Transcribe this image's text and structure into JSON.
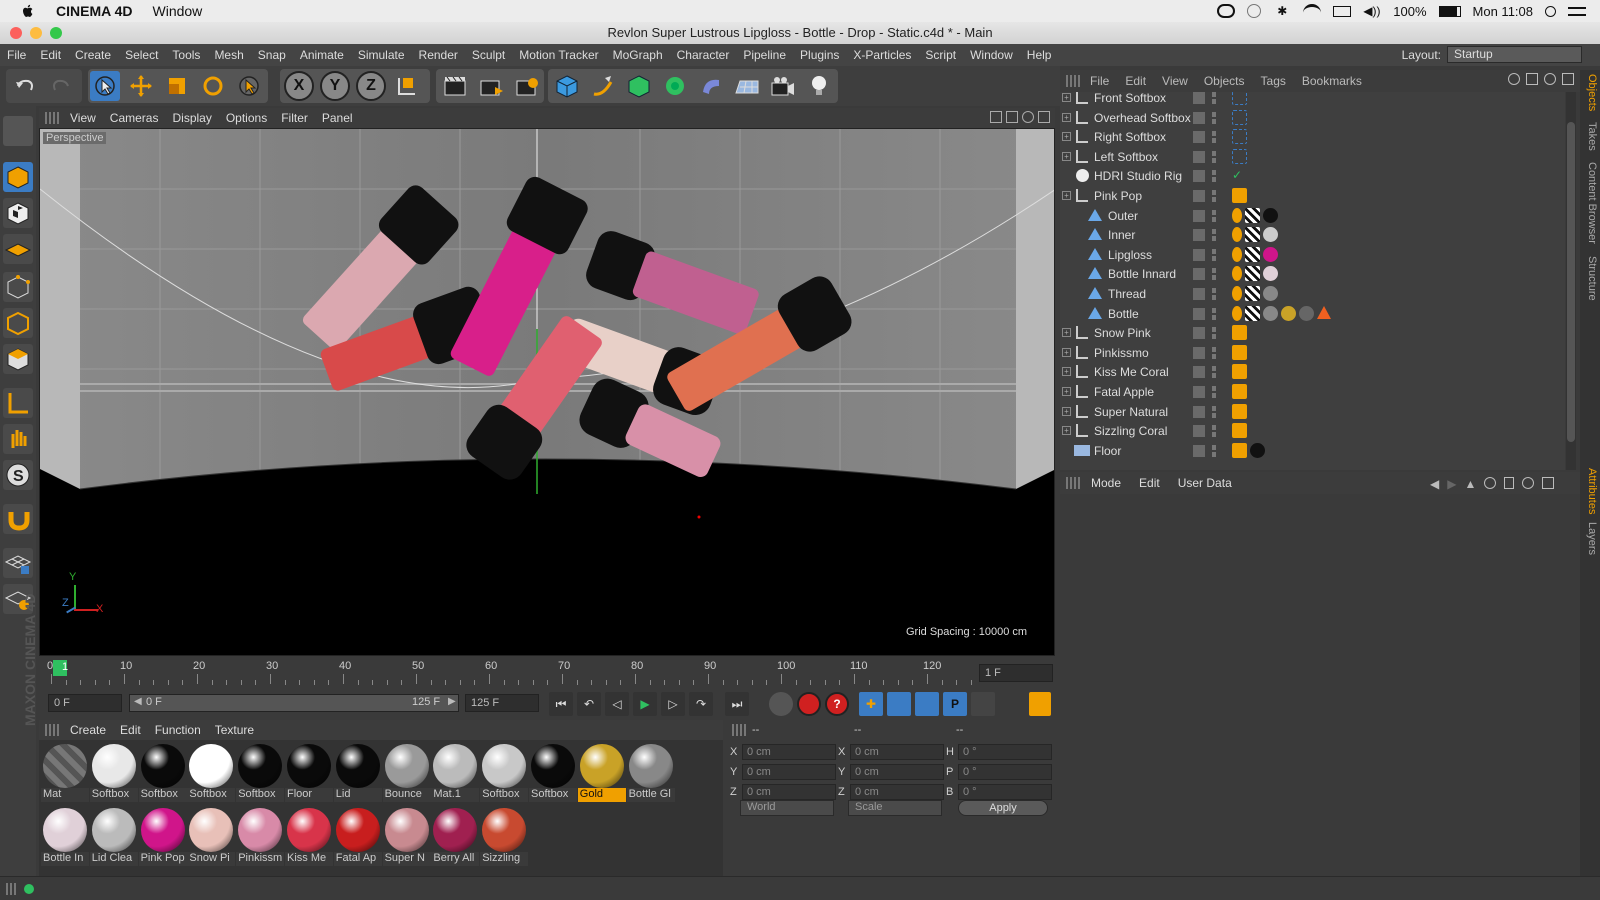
{
  "mac_menubar": {
    "app_name": "CINEMA 4D",
    "menu": [
      "Window"
    ],
    "battery": "100%",
    "clock": "Mon 11:08"
  },
  "window_title": "Revlon Super Lustrous Lipgloss - Bottle - Drop - Static.c4d * - Main",
  "app_menu": [
    "File",
    "Edit",
    "Create",
    "Select",
    "Tools",
    "Mesh",
    "Snap",
    "Animate",
    "Simulate",
    "Render",
    "Sculpt",
    "Motion Tracker",
    "MoGraph",
    "Character",
    "Pipeline",
    "Plugins",
    "X-Particles",
    "Script",
    "Window",
    "Help"
  ],
  "layout": {
    "label": "Layout:",
    "value": "Startup"
  },
  "toolbar_axes": [
    "X",
    "Y",
    "Z"
  ],
  "viewport": {
    "menu": [
      "View",
      "Cameras",
      "Display",
      "Options",
      "Filter",
      "Panel"
    ],
    "camera_label": "Perspective",
    "grid_spacing": "Grid Spacing : 10000 cm",
    "axis_y": "Y",
    "axis_z": "Z",
    "axis_x": "X"
  },
  "timeline": {
    "ticks": [
      "0",
      "10",
      "20",
      "30",
      "40",
      "50",
      "60",
      "70",
      "80",
      "90",
      "100",
      "110",
      "120"
    ],
    "current_frame_marker": "1",
    "frame_display": "1 F",
    "start_field": "0 F",
    "range_start": "0 F",
    "range_end": "125 F",
    "end_field": "125 F"
  },
  "material_manager": {
    "menu": [
      "Create",
      "Edit",
      "Function",
      "Texture"
    ],
    "row1": [
      "Mat",
      "Softbox",
      "Softbox",
      "Softbox",
      "Softbox",
      "Floor",
      "Lid",
      "Bounce",
      "Mat.1",
      "Softbox",
      "Softbox",
      "Gold",
      "Bottle Gl"
    ],
    "row1_colors": [
      "stripe",
      "#e8e8e8",
      "#0a0a0a",
      "#ffffff",
      "#0a0a0a",
      "#0a0a0a",
      "#0a0a0a",
      "#9a9a9a",
      "#bbbbbb",
      "#c8c8c8",
      "#0a0a0a",
      "#c9a227",
      "#888888"
    ],
    "row2": [
      "Bottle In",
      "Lid Clea",
      "Pink Pop",
      "Snow Pi",
      "Pinkissm",
      "Kiss Me",
      "Fatal Ap",
      "Super N",
      "Berry All",
      "Sizzling"
    ],
    "row2_colors": [
      "#e0d0d8",
      "#bbbbbb",
      "#d0158a",
      "#e8c0b8",
      "#d88aa8",
      "#d8344a",
      "#c81e1e",
      "#c88a90",
      "#a02050",
      "#c84a30"
    ],
    "selected": "Gold"
  },
  "coordinates": {
    "header": [
      "--",
      "--",
      "--"
    ],
    "rows": [
      {
        "a": "X",
        "av": "0 cm",
        "b": "X",
        "bv": "0 cm",
        "c": "H",
        "cv": "0 °"
      },
      {
        "a": "Y",
        "av": "0 cm",
        "b": "Y",
        "bv": "0 cm",
        "c": "P",
        "cv": "0 °"
      },
      {
        "a": "Z",
        "av": "0 cm",
        "b": "Z",
        "bv": "0 cm",
        "c": "B",
        "cv": "0 °"
      }
    ],
    "mode1": "World",
    "mode2": "Scale",
    "apply": "Apply"
  },
  "object_manager": {
    "menu": [
      "File",
      "Edit",
      "View",
      "Objects",
      "Tags",
      "Bookmarks"
    ],
    "objects": [
      {
        "name": "Front Softbox",
        "level": 0,
        "type": "null",
        "expand": true
      },
      {
        "name": "Overhead Softbox",
        "level": 0,
        "type": "null",
        "expand": true
      },
      {
        "name": "Right Softbox",
        "level": 0,
        "type": "null",
        "expand": true
      },
      {
        "name": "Left Softbox",
        "level": 0,
        "type": "null",
        "expand": true
      },
      {
        "name": "HDRI Studio Rig",
        "level": 0,
        "type": "sphere",
        "expand": false
      },
      {
        "name": "Pink Pop",
        "level": 0,
        "type": "null",
        "expand": true
      },
      {
        "name": "Outer",
        "level": 1,
        "type": "poly",
        "expand": false
      },
      {
        "name": "Inner",
        "level": 1,
        "type": "poly",
        "expand": false
      },
      {
        "name": "Lipgloss",
        "level": 1,
        "type": "poly",
        "expand": false
      },
      {
        "name": "Bottle Innard",
        "level": 1,
        "type": "poly",
        "expand": false
      },
      {
        "name": "Thread",
        "level": 1,
        "type": "poly",
        "expand": false
      },
      {
        "name": "Bottle",
        "level": 1,
        "type": "poly",
        "expand": false
      },
      {
        "name": "Snow Pink",
        "level": 0,
        "type": "null",
        "expand": true
      },
      {
        "name": "Pinkissmo",
        "level": 0,
        "type": "null",
        "expand": true
      },
      {
        "name": "Kiss Me Coral",
        "level": 0,
        "type": "null",
        "expand": true
      },
      {
        "name": "Fatal Apple",
        "level": 0,
        "type": "null",
        "expand": true
      },
      {
        "name": "Super Natural",
        "level": 0,
        "type": "null",
        "expand": true
      },
      {
        "name": "Sizzling Coral",
        "level": 0,
        "type": "null",
        "expand": true
      },
      {
        "name": "Floor",
        "level": 0,
        "type": "floor",
        "expand": false
      }
    ]
  },
  "attributes_menu": [
    "Mode",
    "Edit",
    "User Data"
  ],
  "right_tabs": [
    "Objects",
    "Takes",
    "Content Browser",
    "Structure",
    "Attributes",
    "Layers"
  ],
  "branding": "MAXON CINEMA 4D",
  "colors": {
    "accent": "#f0a000",
    "panel": "#3a3a3a",
    "selected_tool": "#3b7cc4"
  }
}
